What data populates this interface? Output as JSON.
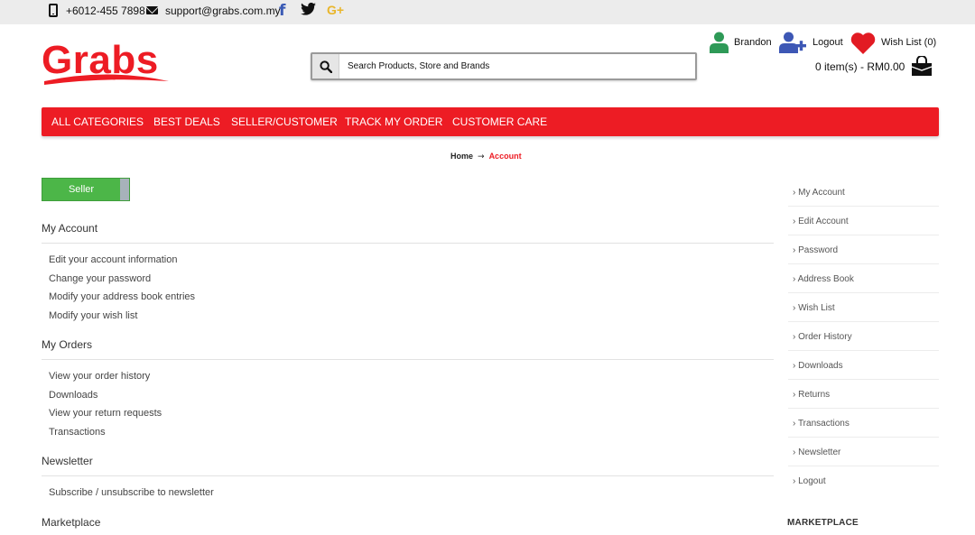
{
  "topbar": {
    "phone": "+6012-455 7898",
    "email": "support@grabs.com.my",
    "icons": [
      "phone-icon",
      "mail-icon",
      "facebook-icon",
      "twitter-icon",
      "google-plus-icon"
    ]
  },
  "header": {
    "logo_text": "Grabs",
    "search_placeholder": "Search Products, Store and Brands",
    "user_name": "Brandon",
    "logout": "Logout",
    "wishlist": "Wish List (0)",
    "cart": "0 item(s) - RM0.00"
  },
  "nav": [
    "ALL CATEGORIES",
    "BEST DEALS",
    "SELLER/CUSTOMER",
    "TRACK MY ORDER",
    "CUSTOMER CARE"
  ],
  "breadcrumb": {
    "home": "Home",
    "current": "Account"
  },
  "seller_toggle": "Seller",
  "sections": [
    {
      "title": "My Account",
      "links": [
        "Edit your account information",
        "Change your password",
        "Modify your address book entries",
        "Modify your wish list"
      ]
    },
    {
      "title": "My Orders",
      "links": [
        "View your order history",
        "Downloads",
        "View your return requests",
        "Transactions"
      ]
    },
    {
      "title": "Newsletter",
      "links": [
        "Subscribe / unsubscribe to newsletter"
      ]
    },
    {
      "title": "Marketplace",
      "links": []
    }
  ],
  "sidebar": {
    "links": [
      "My Account",
      "Edit Account",
      "Password",
      "Address Book",
      "Wish List",
      "Order History",
      "Downloads",
      "Returns",
      "Transactions",
      "Newsletter",
      "Logout"
    ],
    "marketplace_title": "MARKETPLACE"
  },
  "colors": {
    "brand_red": "#ed1c24",
    "seller_green": "#4cb648",
    "user_green": "#2e9a57",
    "user_blue": "#3d57b5"
  }
}
